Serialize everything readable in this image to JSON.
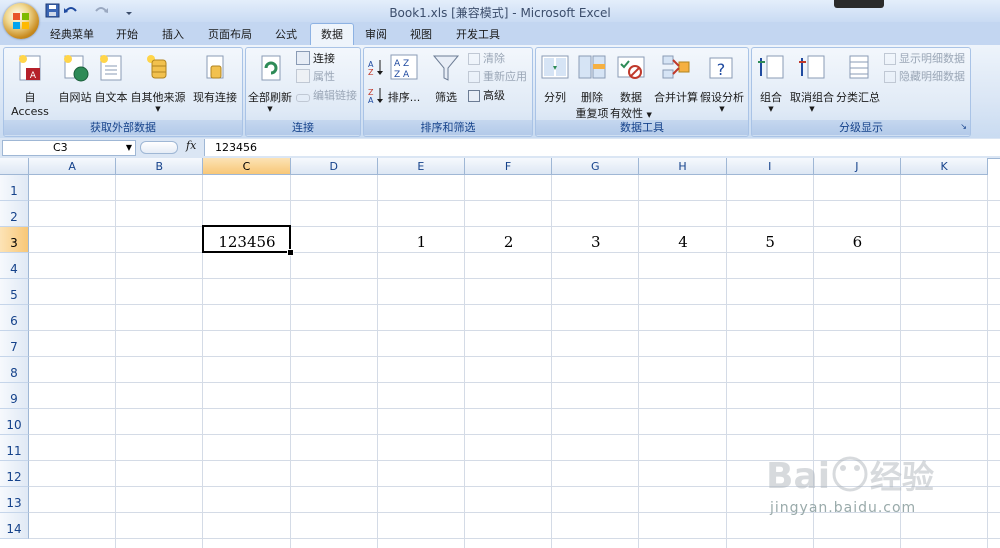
{
  "window": {
    "title": "Book1.xls  [兼容模式] - Microsoft Excel"
  },
  "tabs": [
    {
      "label": "经典菜单"
    },
    {
      "label": "开始"
    },
    {
      "label": "插入"
    },
    {
      "label": "页面布局"
    },
    {
      "label": "公式"
    },
    {
      "label": "数据"
    },
    {
      "label": "审阅"
    },
    {
      "label": "视图"
    },
    {
      "label": "开发工具"
    }
  ],
  "active_tab": "数据",
  "ribbon": {
    "external": {
      "label": "获取外部数据",
      "access": "自 Access",
      "web": "自网站",
      "text": "自文本",
      "other": "自其他来源",
      "existing": "现有连接"
    },
    "connections": {
      "label": "连接",
      "refresh_all": "全部刷新",
      "connections": "连接",
      "properties": "属性",
      "edit_links": "编辑链接"
    },
    "sort_filter": {
      "label": "排序和筛选",
      "sort": "排序...",
      "filter": "筛选",
      "clear": "清除",
      "reapply": "重新应用",
      "advanced": "高级"
    },
    "data_tools": {
      "label": "数据工具",
      "text_to_columns": "分列",
      "remove_dup_1": "删除",
      "remove_dup_2": "重复项",
      "validation_1": "数据",
      "validation_2": "有效性",
      "consolidate": "合并计算",
      "what_if": "假设分析"
    },
    "outline": {
      "label": "分级显示",
      "group": "组合",
      "ungroup": "取消组合",
      "subtotal": "分类汇总",
      "show_detail": "显示明细数据",
      "hide_detail": "隐藏明细数据"
    }
  },
  "formula_bar": {
    "name_box": "C3",
    "fx": "fx",
    "value": "123456"
  },
  "grid": {
    "columns": [
      "A",
      "B",
      "C",
      "D",
      "E",
      "F",
      "G",
      "H",
      "I",
      "J",
      "K"
    ],
    "rows": [
      "1",
      "2",
      "3",
      "4",
      "5",
      "6",
      "7",
      "8",
      "9",
      "10",
      "11",
      "12",
      "13",
      "14"
    ],
    "active_cell": "C3",
    "cells": {
      "C3": "123456",
      "E3": "1",
      "F3": "2",
      "G3": "3",
      "H3": "4",
      "I3": "5",
      "J3": "6"
    }
  },
  "watermark": {
    "brand": "Bai 经验",
    "url": "jingyan.baidu.com"
  },
  "colors": {
    "ribbon_bg": "#dae6f5",
    "header_selected": "#f8c777",
    "grid_line": "#d4dbe6"
  }
}
